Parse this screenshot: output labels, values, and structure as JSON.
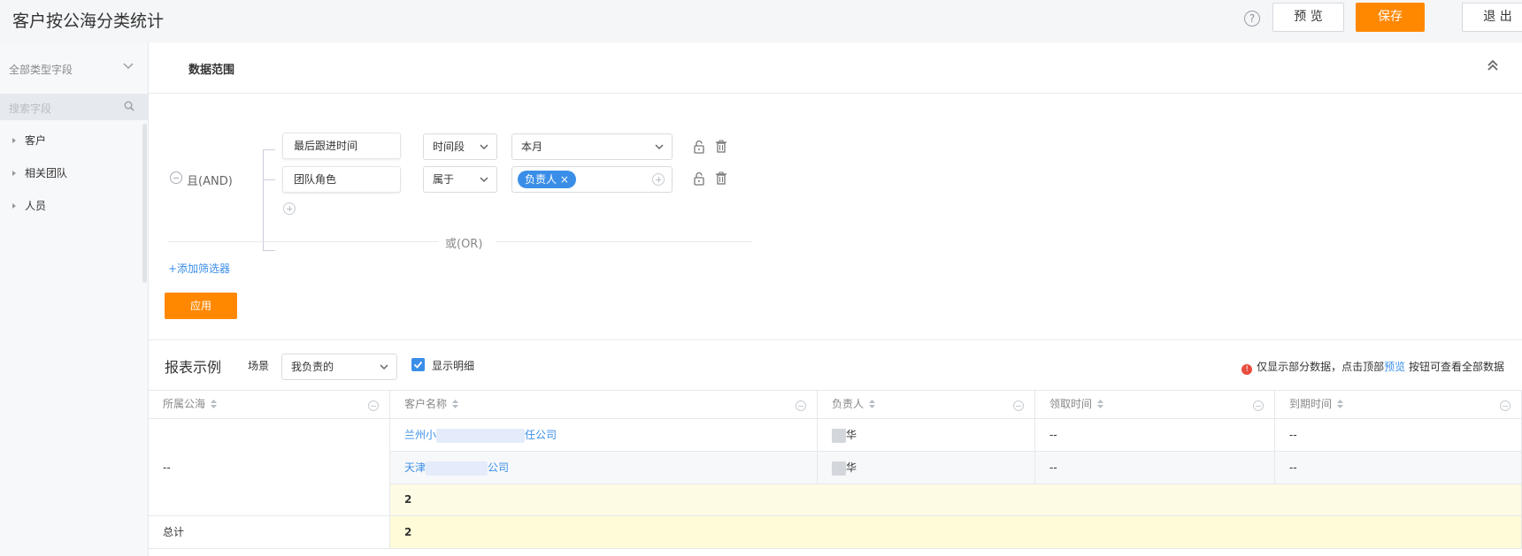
{
  "header": {
    "title": "客户按公海分类统计",
    "help": "?",
    "preview_label": "预 览",
    "save_label": "保存",
    "exit_label": "退 出"
  },
  "sidebar": {
    "type_select": "全部类型字段",
    "search_placeholder": "搜索字段",
    "items": [
      {
        "label": "客户"
      },
      {
        "label": "相关团队"
      },
      {
        "label": "人员"
      }
    ]
  },
  "filter": {
    "section_title": "数据范围",
    "and_label": "且(AND)",
    "rows": [
      {
        "field": "最后跟进时间",
        "operator": "时间段",
        "value": "本月"
      },
      {
        "field": "团队角色",
        "operator": "属于",
        "tag": "负责人 ×"
      }
    ],
    "or_label": "或(OR)",
    "add_filter": "+添加筛选器",
    "apply_label": "应用"
  },
  "report": {
    "title": "报表示例",
    "scene_label": "场景",
    "scene_value": "我负责的",
    "show_detail": "显示明细",
    "notice_prefix": "仅显示部分数据，点击顶部",
    "notice_link": "预览",
    "notice_suffix": "按钮可查看全部数据",
    "notice_icon": "!"
  },
  "table": {
    "headers": [
      "所属公海",
      "客户名称",
      "负责人",
      "领取时间",
      "到期时间"
    ],
    "group_value": "--",
    "rows": [
      {
        "customer_prefix": "兰州小",
        "customer_suffix": "任公司",
        "owner_suffix": "华",
        "claim": "--",
        "expire": "--"
      },
      {
        "customer_prefix": "天津",
        "customer_suffix": "公司",
        "owner_suffix": "华",
        "claim": "--",
        "expire": "--"
      }
    ],
    "subtotal": "2",
    "total_label": "总计",
    "total_value": "2"
  }
}
